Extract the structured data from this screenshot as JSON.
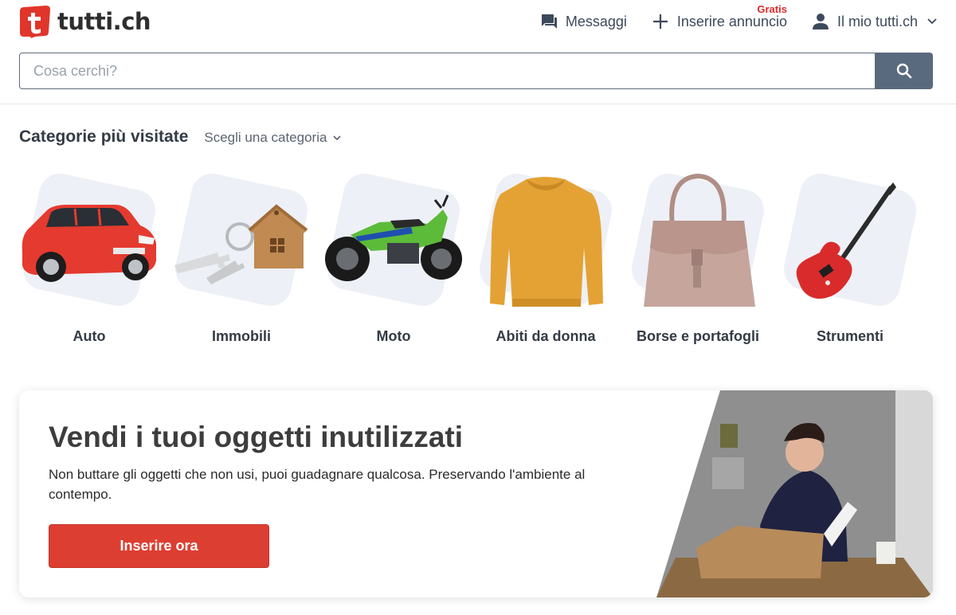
{
  "header": {
    "logo_text": "tutti.ch",
    "nav": {
      "messages": "Messaggi",
      "post_ad": "Inserire annuncio",
      "post_badge": "Gratis",
      "account": "Il mio tutti.ch"
    },
    "search": {
      "placeholder": "Cosa cerchi?",
      "value": ""
    }
  },
  "categories": {
    "title": "Categorie più visitate",
    "select_label": "Scegli una categoria",
    "items": [
      {
        "label": "Auto",
        "icon": "car-image"
      },
      {
        "label": "Immobili",
        "icon": "house-keys-image"
      },
      {
        "label": "Moto",
        "icon": "motorcycle-image"
      },
      {
        "label": "Abiti da donna",
        "icon": "sweater-image"
      },
      {
        "label": "Borse e portafogli",
        "icon": "handbag-image"
      },
      {
        "label": "Strumenti",
        "icon": "guitar-image"
      }
    ]
  },
  "promo": {
    "title": "Vendi i tuoi oggetti inutilizzati",
    "text": "Non buttare gli oggetti che non usi, puoi guadagnare qualcosa. Preservando l'ambiente al contempo.",
    "button": "Inserire ora"
  },
  "colors": {
    "brand_red": "#dc3f32",
    "search_button": "#5a6a7e",
    "tile_bg": "#edf0f6"
  }
}
